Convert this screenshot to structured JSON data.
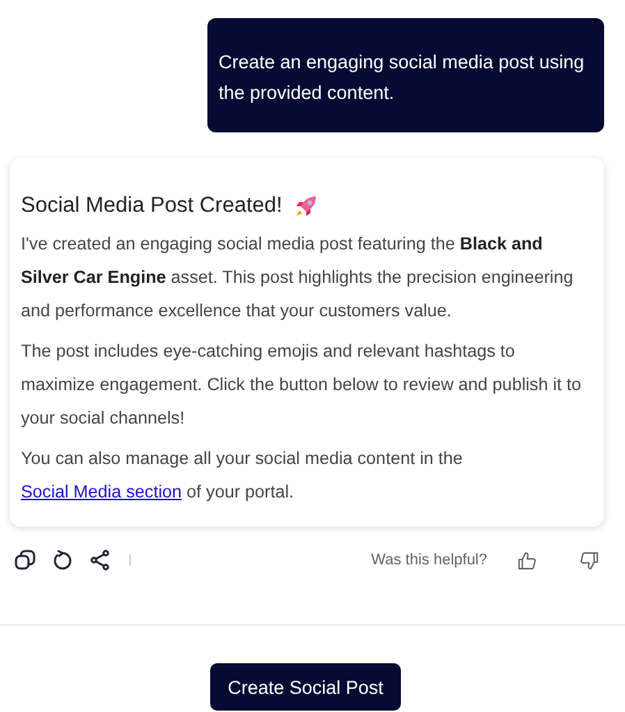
{
  "user_message": "Create an engaging social media post using the provided content.",
  "reply": {
    "title": "Social Media Post Created!",
    "paragraphs": [
      {
        "text": "I've created an engaging social media post featuring the **Black and Silver Car Engine** asset. This post highlights the precision engineering and performance excellence that your customers value."
      },
      {
        "text": "The post includes eye-catching emojis and relevant hashtags to maximize engagement. Click the button below to review and publish it to your social channels!"
      },
      {
        "text": "You can also manage all your social media content in the ",
        "link": "Social Media section",
        "after": " of your portal."
      }
    ]
  },
  "feedback": {
    "prompt": "Was this helpful?"
  },
  "action_button": "Create Social Post"
}
